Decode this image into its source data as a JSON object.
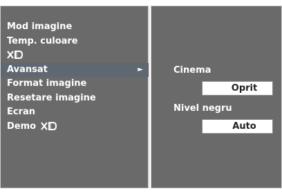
{
  "menu": {
    "items": [
      {
        "label": "Mod imagine"
      },
      {
        "label": "Temp. culoare"
      },
      {
        "label": "XD"
      },
      {
        "label": "Avansat",
        "selected": true,
        "arrow": "►"
      },
      {
        "label": "Format imagine"
      },
      {
        "label": "Resetare imagine"
      },
      {
        "label": "Ecran"
      },
      {
        "label": "Demo",
        "logo": "XD"
      }
    ]
  },
  "submenu": {
    "cinema": {
      "label": "Cinema",
      "value": "Oprit"
    },
    "black_level": {
      "label": "Nivel negru",
      "value": "Auto"
    }
  },
  "colors": {
    "panel_bg": "#6a6a6a",
    "selected_bg": "#5f6870",
    "text": "#ffffff"
  }
}
